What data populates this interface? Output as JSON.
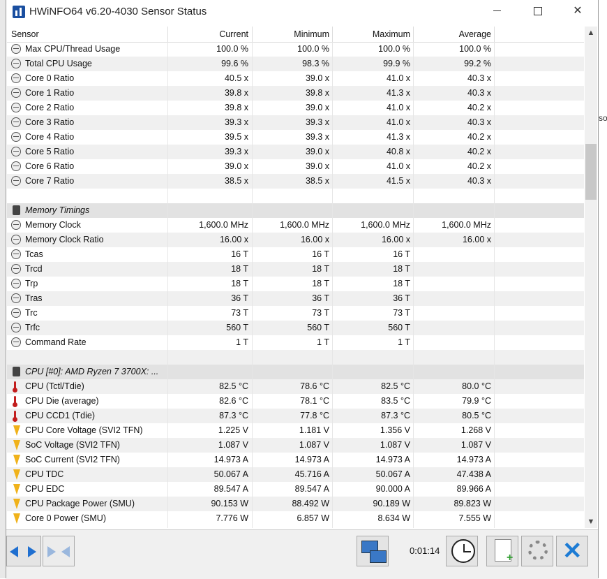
{
  "window": {
    "title": "HWiNFO64 v6.20-4030 Sensor Status"
  },
  "columns": [
    "Sensor",
    "Current",
    "Minimum",
    "Maximum",
    "Average"
  ],
  "rows": [
    {
      "icon": "clock",
      "name": "Max CPU/Thread Usage",
      "cur": "100.0 %",
      "min": "100.0 %",
      "max": "100.0 %",
      "avg": "100.0 %"
    },
    {
      "icon": "clock",
      "name": "Total CPU Usage",
      "cur": "99.6 %",
      "min": "98.3 %",
      "max": "99.9 %",
      "avg": "99.2 %"
    },
    {
      "icon": "clock",
      "name": "Core 0 Ratio",
      "cur": "40.5 x",
      "min": "39.0 x",
      "max": "41.0 x",
      "avg": "40.3 x"
    },
    {
      "icon": "clock",
      "name": "Core 1 Ratio",
      "cur": "39.8 x",
      "min": "39.8 x",
      "max": "41.3 x",
      "avg": "40.3 x"
    },
    {
      "icon": "clock",
      "name": "Core 2 Ratio",
      "cur": "39.8 x",
      "min": "39.0 x",
      "max": "41.0 x",
      "avg": "40.2 x"
    },
    {
      "icon": "clock",
      "name": "Core 3 Ratio",
      "cur": "39.3 x",
      "min": "39.3 x",
      "max": "41.0 x",
      "avg": "40.3 x"
    },
    {
      "icon": "clock",
      "name": "Core 4 Ratio",
      "cur": "39.5 x",
      "min": "39.3 x",
      "max": "41.3 x",
      "avg": "40.2 x"
    },
    {
      "icon": "clock",
      "name": "Core 5 Ratio",
      "cur": "39.3 x",
      "min": "39.0 x",
      "max": "40.8 x",
      "avg": "40.2 x"
    },
    {
      "icon": "clock",
      "name": "Core 6 Ratio",
      "cur": "39.0 x",
      "min": "39.0 x",
      "max": "41.0 x",
      "avg": "40.2 x"
    },
    {
      "icon": "clock",
      "name": "Core 7 Ratio",
      "cur": "38.5 x",
      "min": "38.5 x",
      "max": "41.5 x",
      "avg": "40.3 x"
    },
    {
      "icon": "none",
      "name": "",
      "cur": "",
      "min": "",
      "max": "",
      "avg": ""
    },
    {
      "icon": "chip",
      "name": "Memory Timings",
      "cur": "",
      "min": "",
      "max": "",
      "avg": "",
      "section": true
    },
    {
      "icon": "clock",
      "name": "Memory Clock",
      "cur": "1,600.0 MHz",
      "min": "1,600.0 MHz",
      "max": "1,600.0 MHz",
      "avg": "1,600.0 MHz"
    },
    {
      "icon": "clock",
      "name": "Memory Clock Ratio",
      "cur": "16.00 x",
      "min": "16.00 x",
      "max": "16.00 x",
      "avg": "16.00 x"
    },
    {
      "icon": "clock",
      "name": "Tcas",
      "cur": "16 T",
      "min": "16 T",
      "max": "16 T",
      "avg": ""
    },
    {
      "icon": "clock",
      "name": "Trcd",
      "cur": "18 T",
      "min": "18 T",
      "max": "18 T",
      "avg": ""
    },
    {
      "icon": "clock",
      "name": "Trp",
      "cur": "18 T",
      "min": "18 T",
      "max": "18 T",
      "avg": ""
    },
    {
      "icon": "clock",
      "name": "Tras",
      "cur": "36 T",
      "min": "36 T",
      "max": "36 T",
      "avg": ""
    },
    {
      "icon": "clock",
      "name": "Trc",
      "cur": "73 T",
      "min": "73 T",
      "max": "73 T",
      "avg": ""
    },
    {
      "icon": "clock",
      "name": "Trfc",
      "cur": "560 T",
      "min": "560 T",
      "max": "560 T",
      "avg": ""
    },
    {
      "icon": "clock",
      "name": "Command Rate",
      "cur": "1 T",
      "min": "1 T",
      "max": "1 T",
      "avg": ""
    },
    {
      "icon": "none",
      "name": "",
      "cur": "",
      "min": "",
      "max": "",
      "avg": ""
    },
    {
      "icon": "chip",
      "name": "CPU [#0]: AMD Ryzen 7 3700X: ...",
      "cur": "",
      "min": "",
      "max": "",
      "avg": "",
      "section": true
    },
    {
      "icon": "thermo",
      "name": "CPU (Tctl/Tdie)",
      "cur": "82.5 °C",
      "min": "78.6 °C",
      "max": "82.5 °C",
      "avg": "80.0 °C"
    },
    {
      "icon": "thermo",
      "name": "CPU Die (average)",
      "cur": "82.6 °C",
      "min": "78.1 °C",
      "max": "83.5 °C",
      "avg": "79.9 °C"
    },
    {
      "icon": "thermo",
      "name": "CPU CCD1 (Tdie)",
      "cur": "87.3 °C",
      "min": "77.8 °C",
      "max": "87.3 °C",
      "avg": "80.5 °C"
    },
    {
      "icon": "bolt",
      "name": "CPU Core Voltage (SVI2 TFN)",
      "cur": "1.225 V",
      "min": "1.181 V",
      "max": "1.356 V",
      "avg": "1.268 V"
    },
    {
      "icon": "bolt",
      "name": "SoC Voltage (SVI2 TFN)",
      "cur": "1.087 V",
      "min": "1.087 V",
      "max": "1.087 V",
      "avg": "1.087 V"
    },
    {
      "icon": "bolt",
      "name": "SoC Current (SVI2 TFN)",
      "cur": "14.973 A",
      "min": "14.973 A",
      "max": "14.973 A",
      "avg": "14.973 A"
    },
    {
      "icon": "bolt",
      "name": "CPU TDC",
      "cur": "50.067 A",
      "min": "45.716 A",
      "max": "50.067 A",
      "avg": "47.438 A"
    },
    {
      "icon": "bolt",
      "name": "CPU EDC",
      "cur": "89.547 A",
      "min": "89.547 A",
      "max": "90.000 A",
      "avg": "89.966 A"
    },
    {
      "icon": "bolt",
      "name": "CPU Package Power (SMU)",
      "cur": "90.153 W",
      "min": "88.492 W",
      "max": "90.189 W",
      "avg": "89.823 W"
    },
    {
      "icon": "bolt",
      "name": "Core 0 Power (SMU)",
      "cur": "7.776 W",
      "min": "6.857 W",
      "max": "8.634 W",
      "avg": "7.555 W"
    }
  ],
  "footer": {
    "elapsed": "0:01:14"
  },
  "background": {
    "edge_text": "so"
  }
}
